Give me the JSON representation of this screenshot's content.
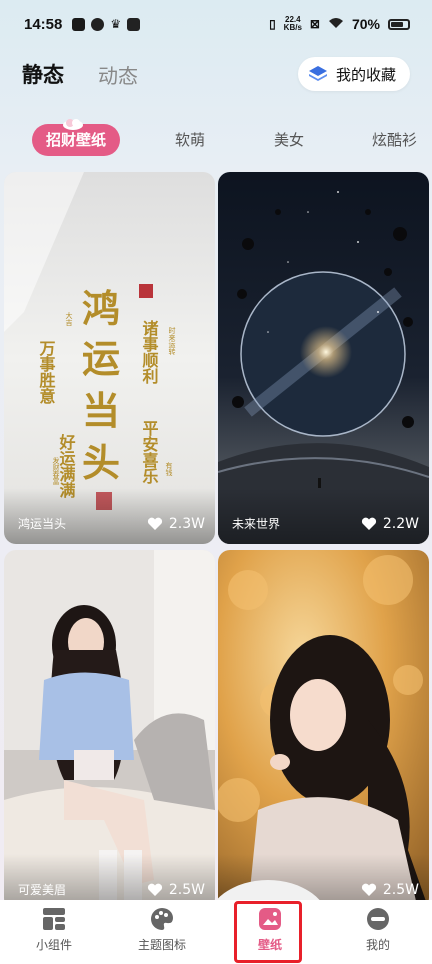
{
  "status_bar": {
    "time": "14:58",
    "net_speed_value": "22.4",
    "net_speed_unit": "KB/s",
    "battery": "70%"
  },
  "header": {
    "tabs": [
      {
        "label": "静态",
        "active": true
      },
      {
        "label": "动态",
        "active": false
      }
    ],
    "favorites_label": "我的收藏"
  },
  "categories": [
    {
      "label": "招财壁纸",
      "active": true
    },
    {
      "label": "软萌",
      "active": false
    },
    {
      "label": "美女",
      "active": false
    },
    {
      "label": "炫酷衫",
      "active": false
    }
  ],
  "cards": [
    {
      "title": "鸿运当头",
      "likes": "2.3W"
    },
    {
      "title": "未来世界",
      "likes": "2.2W"
    },
    {
      "title": "可爱美眉",
      "likes": "2.5W"
    },
    {
      "title": "",
      "likes": "2.5W"
    }
  ],
  "bottom_nav": [
    {
      "label": "小组件",
      "icon": "widget-icon",
      "active": false
    },
    {
      "label": "主题图标",
      "icon": "palette-icon",
      "active": false
    },
    {
      "label": "壁纸",
      "icon": "wallpaper-icon",
      "active": true
    },
    {
      "label": "我的",
      "icon": "profile-icon",
      "active": false
    }
  ],
  "colors": {
    "accent": "#e45b86",
    "highlight_box": "#e8202a"
  }
}
